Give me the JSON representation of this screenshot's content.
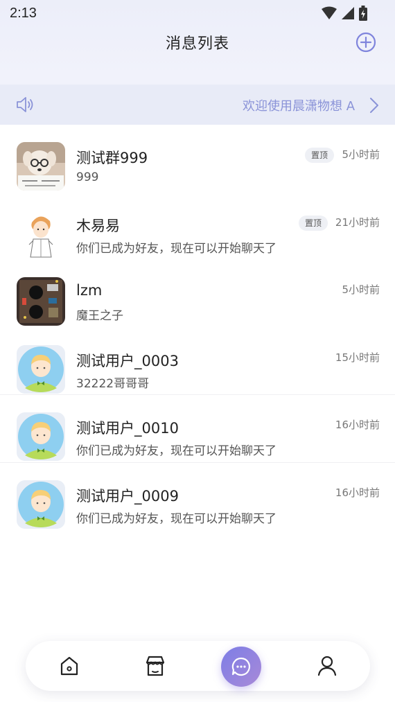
{
  "status_bar": {
    "time": "2:13"
  },
  "header": {
    "title": "消息列表"
  },
  "notice": {
    "text": "欢迎使用晨潇物想 A"
  },
  "conversations": [
    {
      "name": "测试群999",
      "preview": "999",
      "time": "5小时前",
      "pinned_label": "置顶",
      "avatar": "puppy-photo"
    },
    {
      "name": "木易易",
      "preview": "你们已成为好友，现在可以开始聊天了",
      "time": "21小时前",
      "pinned_label": "置顶",
      "avatar": "cartoon-boy"
    },
    {
      "name": "lzm",
      "preview": "魔王之子",
      "time": "5小时前",
      "avatar": "circuit-board-photo"
    },
    {
      "name": "测试用户_0003",
      "preview": "32222哥哥哥",
      "time": "15小时前",
      "avatar": "default-user"
    },
    {
      "name": "测试用户_0010",
      "preview": "你们已成为好友，现在可以开始聊天了",
      "time": "16小时前",
      "avatar": "default-user"
    },
    {
      "name": "测试用户_0009",
      "preview": "你们已成为好友，现在可以开始聊天了",
      "time": "16小时前",
      "avatar": "default-user"
    }
  ],
  "tabbar": {
    "items": [
      {
        "icon": "home-icon"
      },
      {
        "icon": "store-icon"
      },
      {
        "icon": "chat-icon",
        "active": true
      },
      {
        "icon": "profile-icon"
      }
    ]
  },
  "colors": {
    "accent": "#8a93d8",
    "chat_gradient_start": "#7d7ee6",
    "chat_gradient_end": "#a889d8"
  }
}
